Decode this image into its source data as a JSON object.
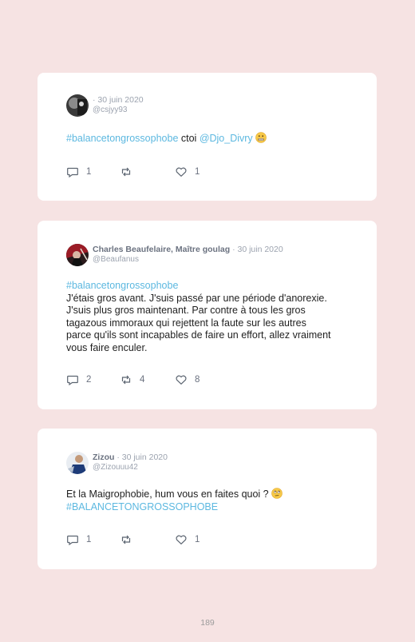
{
  "tweets": [
    {
      "name": "",
      "date": "· 30 juin 2020",
      "handle": "@csjyy93",
      "tag": "#balancetongrossophobe",
      "text_mid": " ctoi ",
      "mention": "@Djo_Divry",
      "emoji": "grimacing-face",
      "replies": "1",
      "retweets": "",
      "likes": "1"
    },
    {
      "name": "Charles Beaufelaire, Maître goulag",
      "date": "· 30 juin 2020",
      "handle": "@Beaufanus",
      "tag": "#balancetongrossophobe",
      "lines": [
        "J'étais gros avant. J'suis passé par une période d'anorexie.",
        "J'suis plus gros maintenant. Par contre à tous les gros",
        "tagazous immoraux qui rejettent la faute sur les autres",
        "parce qu'ils sont incapables de faire un effort, allez vraiment",
        "vous faire enculer."
      ],
      "replies": "2",
      "retweets": "4",
      "likes": "8"
    },
    {
      "name": "Zizou",
      "date": "· 30 juin 2020",
      "handle": "@Zizouuu42",
      "text": "Et la Maigrophobie, hum vous en faites quoi ? ",
      "emoji": "face-with-rolling-eyes",
      "tag": "#BALANCETONGROSSOPHOBE",
      "replies": "1",
      "retweets": "",
      "likes": "1"
    }
  ],
  "page_number": "189",
  "colors": {
    "background": "#f6e3e3",
    "card": "#ffffff",
    "hashtag": "#5cb8e0",
    "muted": "#9ca3af",
    "name": "#6b7280"
  }
}
